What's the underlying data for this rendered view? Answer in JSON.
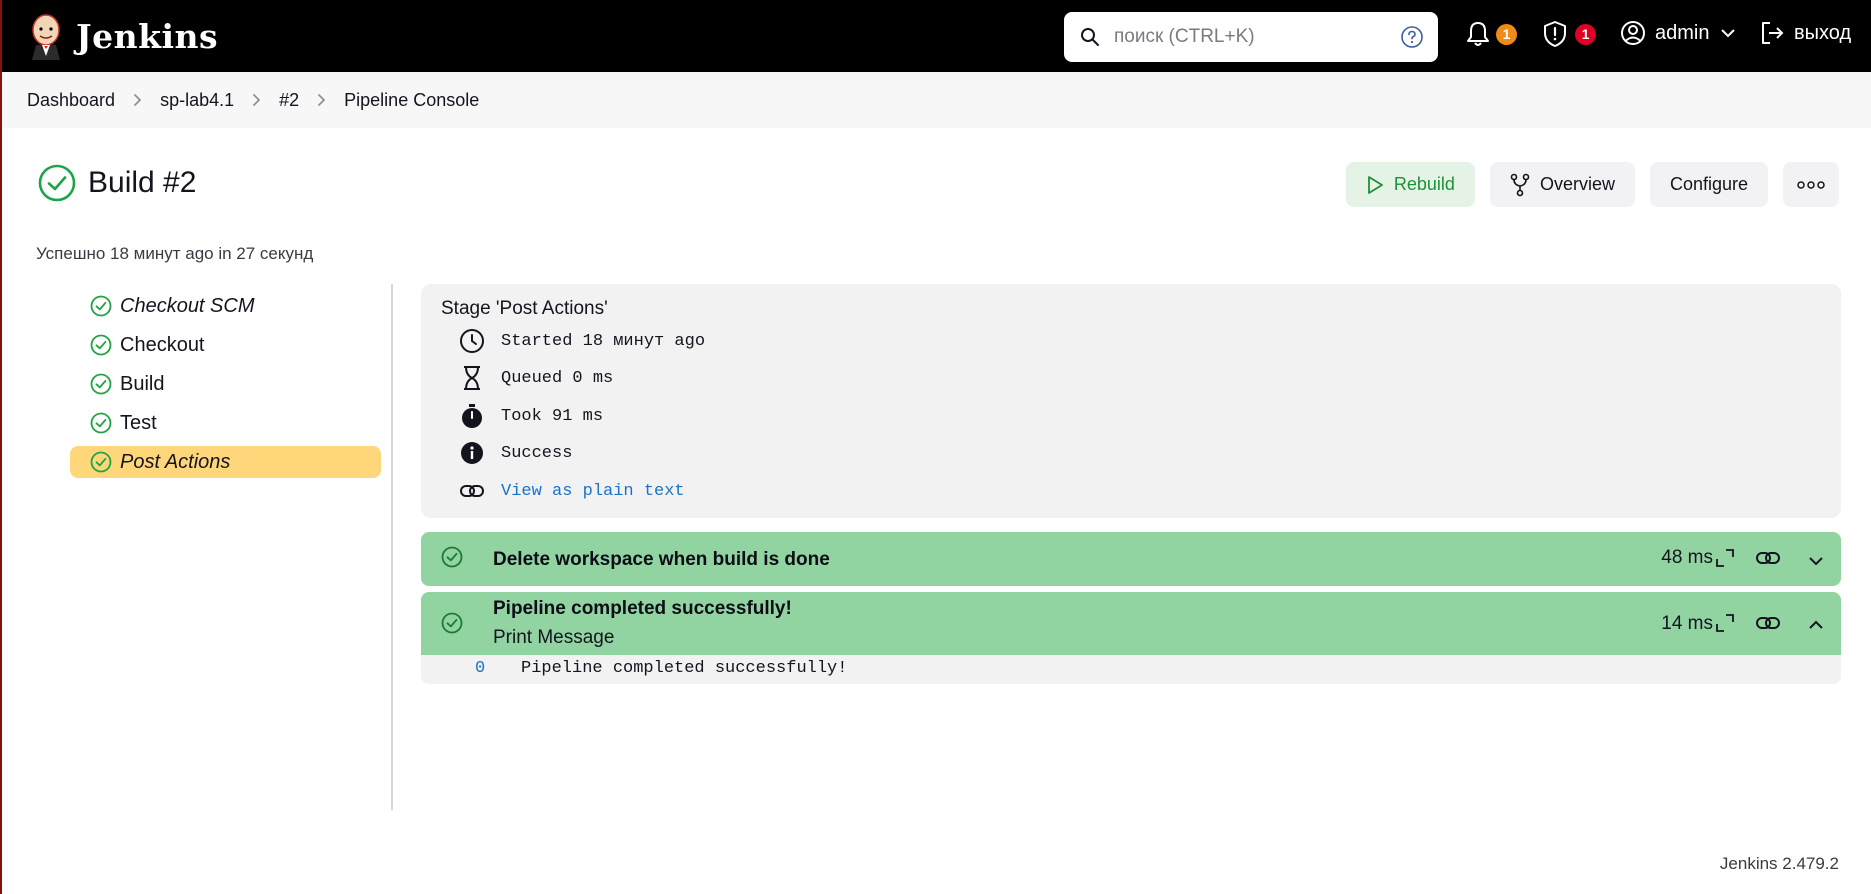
{
  "header": {
    "brand": "Jenkins",
    "search_placeholder": "поиск (CTRL+K)",
    "notifications_count": "1",
    "security_count": "1",
    "user": "admin",
    "logout": "выход"
  },
  "breadcrumb": [
    "Dashboard",
    "sp-lab4.1",
    "#2",
    "Pipeline Console"
  ],
  "build": {
    "title": "Build #2",
    "summary": "Успешно 18 минут ago in 27 секунд"
  },
  "actions": {
    "rebuild": "Rebuild",
    "overview": "Overview",
    "configure": "Configure"
  },
  "stages": [
    {
      "label": "Checkout SCM",
      "italic": true,
      "active": false
    },
    {
      "label": "Checkout",
      "italic": false,
      "active": false
    },
    {
      "label": "Build",
      "italic": false,
      "active": false
    },
    {
      "label": "Test",
      "italic": false,
      "active": false
    },
    {
      "label": "Post Actions",
      "italic": true,
      "active": true
    }
  ],
  "stage_details": {
    "title": "Stage 'Post Actions'",
    "started": "Started 18 минут ago",
    "queued": "Queued 0 ms",
    "took": "Took 91 ms",
    "status": "Success",
    "plain_text_link": "View as plain text"
  },
  "steps": [
    {
      "name": "Delete workspace when build is done",
      "sub": "",
      "duration": "48 ms",
      "expanded": false
    },
    {
      "name": "Pipeline completed successfully!",
      "sub": "Print Message",
      "duration": "14 ms",
      "expanded": true
    }
  ],
  "log": {
    "line_number": "0",
    "text": "Pipeline completed successfully!"
  },
  "footer": {
    "version": "Jenkins 2.479.2"
  },
  "colors": {
    "success": "#1ea446",
    "step_bg": "#91d4a2",
    "active_stage": "#ffd77a",
    "link": "#1a73c8"
  }
}
